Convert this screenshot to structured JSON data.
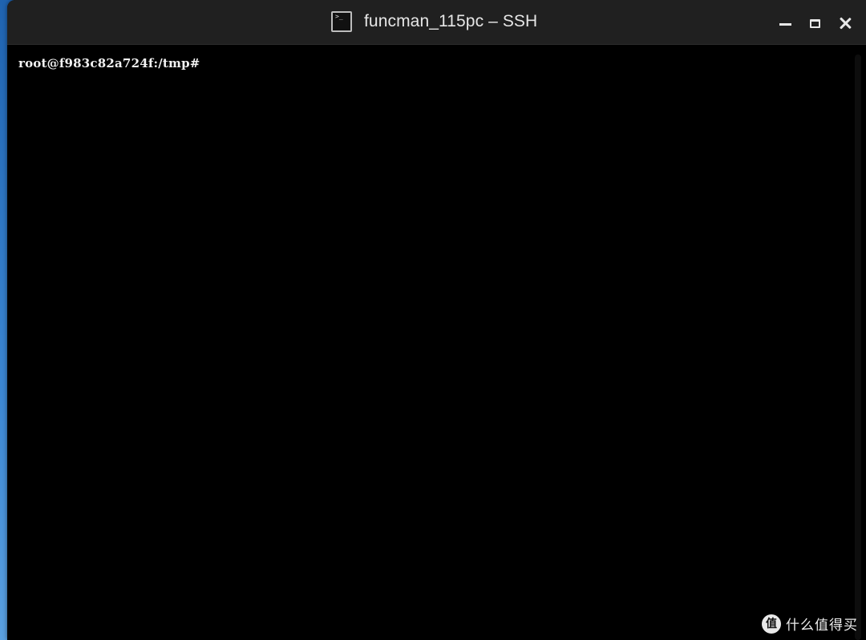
{
  "window": {
    "title": "funcman_115pc – SSH",
    "icon": "terminal-icon",
    "controls": {
      "minimize_icon": "minimize-icon",
      "maximize_icon": "maximize-icon",
      "close_icon": "close-icon"
    }
  },
  "terminal": {
    "prompt": "root@f983c82a724f:/tmp#",
    "background": "#000000",
    "foreground": "#f2f2f2"
  },
  "watermark": {
    "logo_glyph": "值",
    "text": "什么值得买"
  }
}
